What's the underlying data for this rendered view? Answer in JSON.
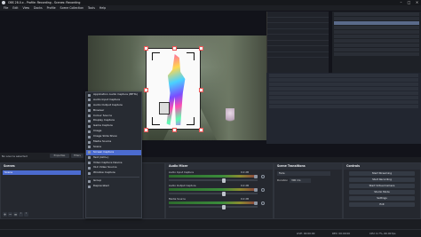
{
  "window": {
    "title": "OBS 28.0.x - Profile: Recording - Scenes: Recording"
  },
  "menu": [
    "File",
    "Edit",
    "View",
    "Docks",
    "Profile",
    "Scene Collection",
    "Tools",
    "Help"
  ],
  "source_status": {
    "label": "No source selected",
    "properties": "Properties",
    "filters": "Filters"
  },
  "add_source_menu": {
    "items": [
      "Application Audio Capture (BETA)",
      "Audio Input Capture",
      "Audio Output Capture",
      "Browser",
      "Colour Source",
      "Display Capture",
      "Game Capture",
      "Image",
      "Image Slide Show",
      "Media Source",
      "Scene",
      "Screen Capture",
      "Text (GDI+)",
      "Video Capture Device",
      "VLC Video Source",
      "Window Capture",
      "Group",
      "Deprecated"
    ],
    "highlighted_index": 11
  },
  "docks": {
    "scenes": {
      "title": "Scenes",
      "items": [
        "Scene"
      ]
    },
    "mixer": {
      "title": "Audio Mixer",
      "channels": [
        {
          "name": "Audio Input Capture",
          "db": "0.0 dB",
          "level": 0.62
        },
        {
          "name": "Audio Output Capture",
          "db": "0.0 dB",
          "level": 0.62
        },
        {
          "name": "Media Source",
          "db": "0.0 dB",
          "level": 0.62
        }
      ]
    },
    "transitions": {
      "title": "Scene Transitions",
      "transition": "Fade",
      "duration_label": "Duration",
      "duration": "300 ms"
    },
    "controls": {
      "title": "Controls",
      "buttons": [
        "Start Streaming",
        "Start Recording",
        "Start Virtual Camera",
        "Studio Mode",
        "Settings",
        "Exit"
      ]
    }
  },
  "status": {
    "live": "LIVE: 00:00:00",
    "rec": "REC: 00:00:00",
    "cpu": "CPU: 0.7%, 60.00 fps"
  }
}
